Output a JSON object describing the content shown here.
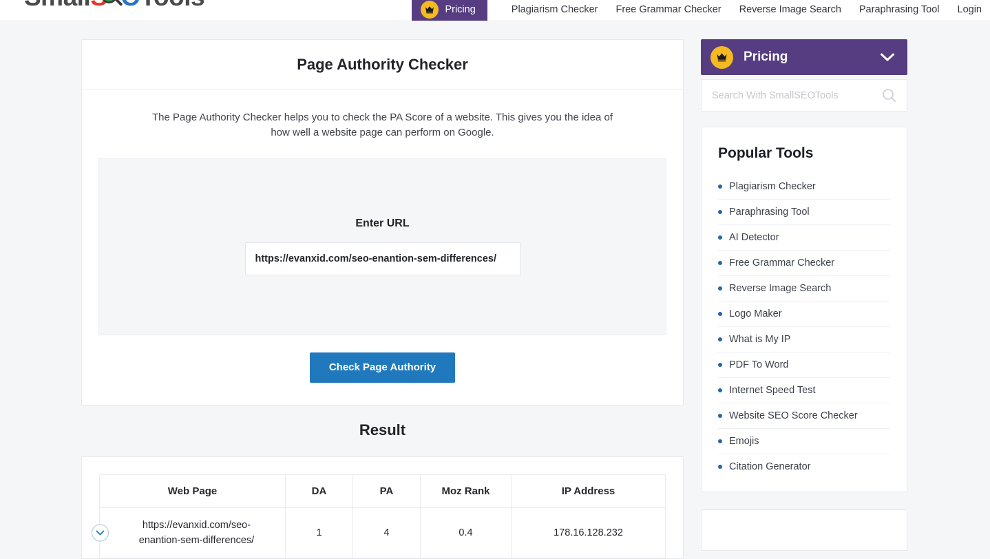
{
  "header": {
    "logo": {
      "prefix": "Small",
      "s": "S",
      "e_icon": "magnifier-green",
      "o": "O",
      "suffix": "Tools"
    },
    "pricing_button": {
      "label": "Pricing",
      "icon": "crown-icon",
      "bg": "#563D82",
      "badge_bg": "#F5B921"
    },
    "nav_items": [
      {
        "label": "Plagiarism Checker"
      },
      {
        "label": "Free Grammar Checker"
      },
      {
        "label": "Reverse Image Search"
      },
      {
        "label": "Paraphrasing Tool"
      },
      {
        "label": "Login"
      }
    ]
  },
  "main": {
    "tool_title": "Page Authority Checker",
    "tool_description": "The Page Authority Checker helps you to check the PA Score of a website. This gives you the idea of how well a website page can perform on Google.",
    "enter_url_label": "Enter URL",
    "url_value": "https://evanxid.com/seo-enantion-sem-differences/",
    "url_placeholder": "Enter URL",
    "check_button": "Check Page Authority",
    "check_button_color": "#2079BD",
    "result_heading": "Result"
  },
  "result_table": {
    "columns": [
      "Web Page",
      "DA",
      "PA",
      "Moz Rank",
      "IP Address"
    ],
    "rows": [
      {
        "web_page": "https://evanxid.com/seo-enantion-sem-differences/",
        "da": "1",
        "pa": "4",
        "moz_rank": "0.4",
        "ip_address": "178.16.128.232",
        "expand_icon": "chevron-down-circle-icon"
      }
    ]
  },
  "sidebar": {
    "pricing": {
      "label": "Pricing",
      "icon": "crown-icon",
      "chevron": "chevron-down-icon",
      "bg": "#563D82"
    },
    "search": {
      "value": "",
      "placeholder": "Search With SmallSEOTools",
      "icon": "search-icon"
    },
    "popular_tools_title": "Popular Tools",
    "popular_tools": [
      {
        "label": "Plagiarism Checker"
      },
      {
        "label": "Paraphrasing Tool"
      },
      {
        "label": "AI Detector"
      },
      {
        "label": "Free Grammar Checker"
      },
      {
        "label": "Reverse Image Search"
      },
      {
        "label": "Logo Maker"
      },
      {
        "label": "What is My IP"
      },
      {
        "label": "PDF To Word"
      },
      {
        "label": "Internet Speed Test"
      },
      {
        "label": "Website SEO Score Checker"
      },
      {
        "label": "Emojis"
      },
      {
        "label": "Citation Generator"
      }
    ]
  }
}
